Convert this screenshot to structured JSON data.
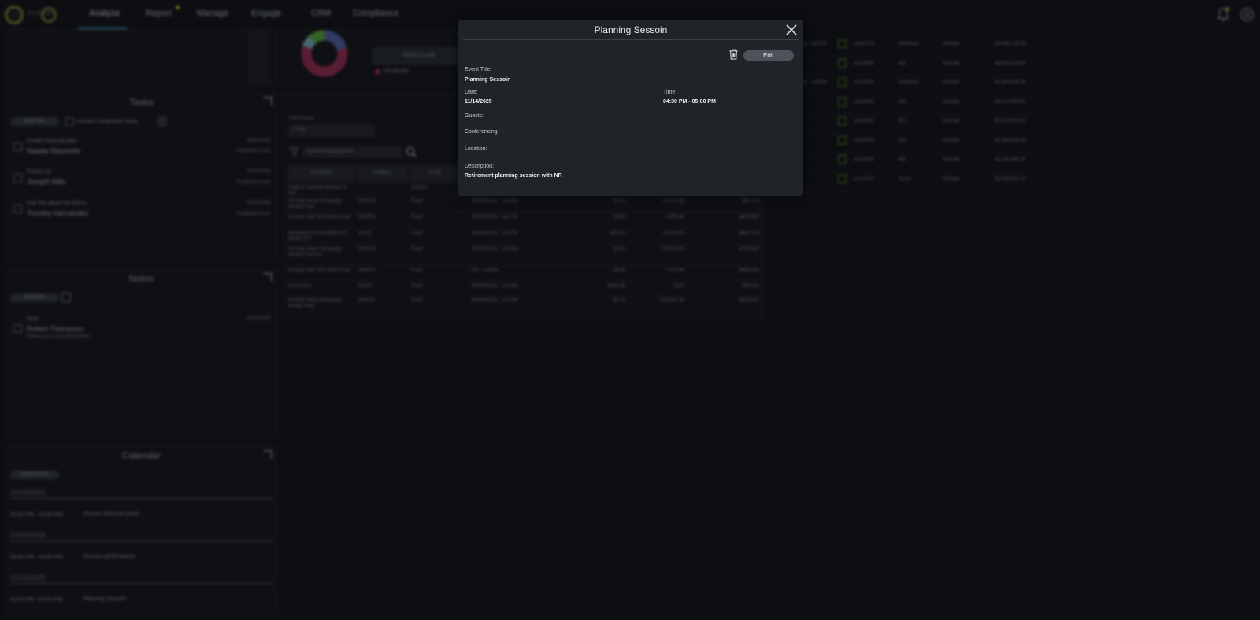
{
  "nav": {
    "logo_text": "FIDELITY",
    "items": [
      {
        "label": "Analyze"
      },
      {
        "label": "Report"
      },
      {
        "label": "Manage"
      },
      {
        "label": "Engage"
      },
      {
        "label": "CRM"
      },
      {
        "label": "Compliance"
      }
    ]
  },
  "tasks": {
    "title": "Tasks",
    "new_task_label": "New Task",
    "include_completed_label": "Include Completed Tasks",
    "items": [
      {
        "title": "Create financial plan",
        "person": "Natalie Reynolds",
        "date": "10/31/2025",
        "assigned": "Assigned to you"
      },
      {
        "title": "Follow Up",
        "person": "Joseph Mills",
        "date": "10/30/2025",
        "assigned": "Assigned to you"
      },
      {
        "title": "Call Tim about his RSUs",
        "person": "Timothy Hernandez",
        "date": "10/29/2025",
        "assigned": "Assigned to you"
      }
    ]
  },
  "notes": {
    "title": "Notes",
    "new_note_label": "New Note",
    "items": [
      {
        "title": "Note",
        "person": "Robert Thompson",
        "date": "10/29/2025",
        "snippet": "Robert has a dog named Fido"
      }
    ]
  },
  "calendar": {
    "title": "Calendar",
    "create_event_label": "Create Event",
    "groups": [
      {
        "date": "10/29/2025",
        "time": "02:00 PM - 03:00 PM",
        "event": "Discuss financial goals"
      },
      {
        "date": "10/30/2025",
        "time": "04:00 PM - 04:00 PM",
        "event": "Discuss performance"
      },
      {
        "date": "11/14/2025",
        "time": "04:30 PM - 05:00 PM",
        "event": "Planning Sessoin"
      }
    ]
  },
  "allocation": {
    "tab_label": "ASSET CLASS",
    "legend_item": "US Stocks"
  },
  "holdings": {
    "time_period_label": "Time Period",
    "time_period_value": "1 Year",
    "search_placeholder": "Search Holding Name",
    "columns": [
      "HOLDING",
      "SYMBOL",
      "TYPE"
    ],
    "rows": [
      {
        "name": "PUBLIC SUPER MARKETS INC",
        "symbol": "-",
        "type": "STOCK",
        "account": "",
        "price": "",
        "qty": "",
        "value": ""
      },
      {
        "name": "Schwab Value Advantage Money Fund",
        "symbol": "SWVXX",
        "type": "Fund",
        "account": "INDIVIDUAL - xx1034",
        "price": "$1.00",
        "qty": "90,278.98",
        "value": "$90,279"
      },
      {
        "name": "Schwab S&P 500 Index Fund",
        "symbol": "SWPPX",
        "type": "Fund",
        "account": "INDIVIDUAL - xx1776",
        "price": "$3.68",
        "qty": "4,963.48",
        "value": "$633,856"
      },
      {
        "name": "SCHWAB US AGGREGATE BOND ETF",
        "symbol": "SCHZ",
        "type": "Fund",
        "account": "INDIVIDUAL - xx1776",
        "price": "$23.33",
        "qty": "26,378.97",
        "value": "$652,373"
      },
      {
        "name": "Schwab Value Advantage Money Fund Inv",
        "symbol": "SWVXX",
        "type": "Fund",
        "account": "INDIVIDUAL - xx3783",
        "price": "$1.00",
        "qty": "779,542.53",
        "value": "$779,542"
      },
      {
        "name": "Schwab S&P 500 Index Fund",
        "symbol": "SWPPX",
        "type": "Fund",
        "account": "IRA - xx2506",
        "price": "$3.68",
        "qty": "7,370.46",
        "value": "$565,405"
      },
      {
        "name": "Ferrari N.V.",
        "symbol": "RACE",
        "type": "Stock",
        "account": "INDIVIDUAL - xx1034",
        "price": "$462.95",
        "qty": "1225",
        "value": "$96,015"
      },
      {
        "name": "Schwab Value Advantage Money Fund",
        "symbol": "SWVXX",
        "type": "Fund",
        "account": "INDIVIDUAL - xx1776",
        "price": "$1.00",
        "qty": "523,602.36",
        "value": "$523,602"
      }
    ]
  },
  "accounts": {
    "rows": [
      {
        "acct": "AL - xx1776",
        "num": "xxxx1776",
        "kind": "Individual",
        "custodian": "Schwab",
        "value": "$4,445,145.38"
      },
      {
        "acct": "",
        "num": "xxxx2506",
        "kind": "IRA",
        "custodian": "Schwab",
        "value": "$3,593,238.53"
      },
      {
        "acct": "AL - xx1034",
        "num": "xxxx1034",
        "kind": "Individual",
        "custodian": "Schwab",
        "value": "$2,844,826.36"
      },
      {
        "acct": "",
        "num": "xxxx8003",
        "kind": "IRA",
        "custodian": "Schwab",
        "value": "$3,573,954.90"
      },
      {
        "acct": "",
        "num": "xxxx3026",
        "kind": "IRA",
        "custodian": "Schwab",
        "value": "$2,573,659.64"
      },
      {
        "acct": "",
        "num": "xxxx3009",
        "kind": "IRA",
        "custodian": "Schwab",
        "value": "$2,866,092.29"
      },
      {
        "acct": "",
        "num": "xxxx3783",
        "kind": "IRA",
        "custodian": "Schwab",
        "value": "$2,733,098.35"
      },
      {
        "acct": "",
        "num": "xxxx7270",
        "kind": "Trusts",
        "custodian": "Schwab",
        "value": "$2,635,900.72"
      }
    ]
  },
  "modal": {
    "title": "Planning Sessoin",
    "edit_label": "Edit",
    "event_title_label": "Event Title:",
    "event_title_value": "Planning Sessoin",
    "date_label": "Date:",
    "date_value": "11/14/2025",
    "time_label": "Time:",
    "time_value": "04:30 PM - 05:00 PM",
    "guests_label": "Guests:",
    "conferencing_label": "Conferencing:",
    "location_label": "Location:",
    "description_label": "Description:",
    "description_value": "Retirement planning session with NR"
  },
  "colors": {
    "accent": "#4aa3df",
    "notification_dot": "#e1c341",
    "icon_green": "#5fb642"
  }
}
